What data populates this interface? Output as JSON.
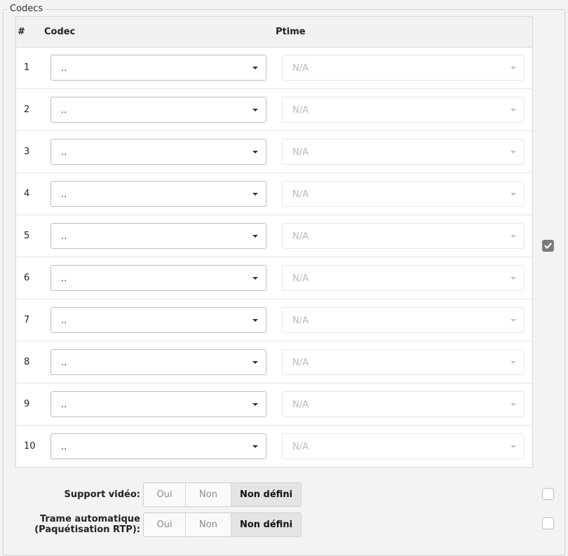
{
  "fieldset": {
    "legend": "Codecs"
  },
  "table": {
    "headers": {
      "num": "#",
      "codec": "Codec",
      "ptime": "Ptime"
    },
    "rows": [
      {
        "num": "1",
        "codec": "..",
        "ptime": "N/A"
      },
      {
        "num": "2",
        "codec": "..",
        "ptime": "N/A"
      },
      {
        "num": "3",
        "codec": "..",
        "ptime": "N/A"
      },
      {
        "num": "4",
        "codec": "..",
        "ptime": "N/A"
      },
      {
        "num": "5",
        "codec": "..",
        "ptime": "N/A"
      },
      {
        "num": "6",
        "codec": "..",
        "ptime": "N/A"
      },
      {
        "num": "7",
        "codec": "..",
        "ptime": "N/A"
      },
      {
        "num": "8",
        "codec": "..",
        "ptime": "N/A"
      },
      {
        "num": "9",
        "codec": "..",
        "ptime": "N/A"
      },
      {
        "num": "10",
        "codec": "..",
        "ptime": "N/A"
      }
    ]
  },
  "codecs_override_checked": true,
  "video_support": {
    "label": "Support vidéo:",
    "options": [
      "Oui",
      "Non",
      "Non défini"
    ],
    "selected": "Non défini",
    "override_checked": false
  },
  "auto_frame": {
    "label_line1": "Trame automatique",
    "label_line2": "(Paquétisation RTP):",
    "options": [
      "Oui",
      "Non",
      "Non défini"
    ],
    "selected": "Non défini",
    "override_checked": false
  }
}
